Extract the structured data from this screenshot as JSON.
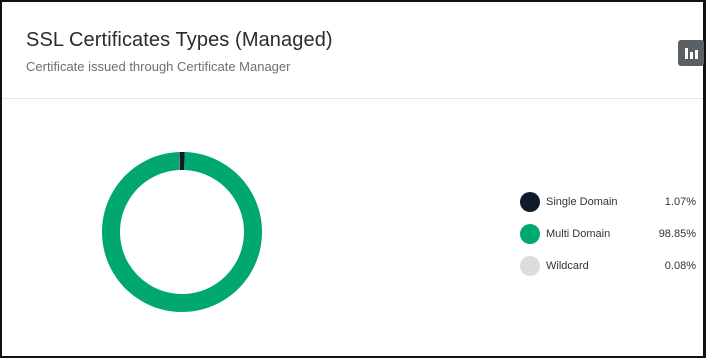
{
  "card": {
    "title": "SSL Certificates Types (Managed)",
    "subtitle": "Certificate issued through Certificate Manager"
  },
  "toolbar": {
    "chart_icon": "bar-chart-icon"
  },
  "chart_data": {
    "type": "pie",
    "variant": "donut",
    "categories": [
      "Single Domain",
      "Multi Domain",
      "Wildcard"
    ],
    "values": [
      1.07,
      98.85,
      0.08
    ],
    "value_labels": [
      "1.07%",
      "98.85%",
      "0.08%"
    ],
    "colors": [
      "#0d1b2a",
      "#00a76f",
      "#dddddd"
    ],
    "legend_position": "right"
  }
}
